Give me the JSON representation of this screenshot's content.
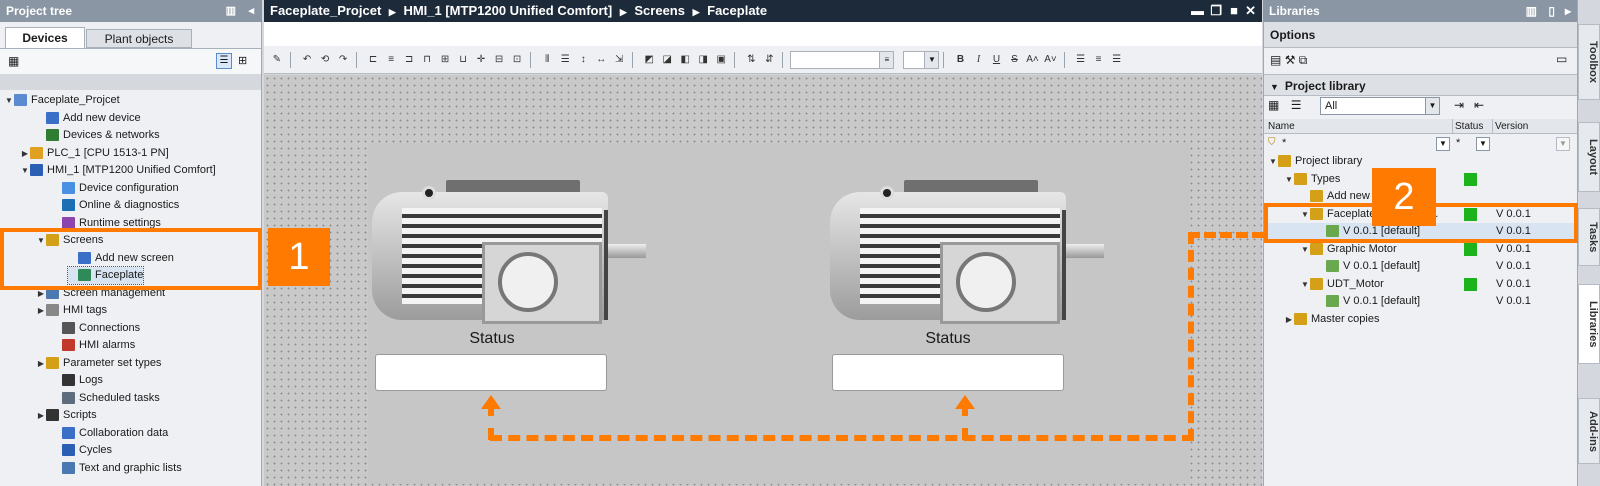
{
  "left_panel": {
    "title": "Project tree",
    "tabs": [
      "Devices",
      "Plant objects"
    ],
    "tree": [
      {
        "label": "Faceplate_Projcet",
        "indent": 0,
        "arrow": "▼"
      },
      {
        "label": "Add new device",
        "indent": 2,
        "arrow": ""
      },
      {
        "label": "Devices & networks",
        "indent": 2,
        "arrow": ""
      },
      {
        "label": "PLC_1 [CPU 1513-1 PN]",
        "indent": 1,
        "arrow": "▶"
      },
      {
        "label": "HMI_1 [MTP1200 Unified Comfort]",
        "indent": 1,
        "arrow": "▼"
      },
      {
        "label": "Device configuration",
        "indent": 3,
        "arrow": ""
      },
      {
        "label": "Online & diagnostics",
        "indent": 3,
        "arrow": ""
      },
      {
        "label": "Runtime settings",
        "indent": 3,
        "arrow": ""
      },
      {
        "label": "Screens",
        "indent": 2,
        "arrow": "▼"
      },
      {
        "label": "Add new screen",
        "indent": 4,
        "arrow": ""
      },
      {
        "label": "Faceplate",
        "indent": 4,
        "arrow": ""
      },
      {
        "label": "Screen management",
        "indent": 2,
        "arrow": "▶"
      },
      {
        "label": "HMI tags",
        "indent": 2,
        "arrow": "▶"
      },
      {
        "label": "Connections",
        "indent": 3,
        "arrow": ""
      },
      {
        "label": "HMI alarms",
        "indent": 3,
        "arrow": ""
      },
      {
        "label": "Parameter set types",
        "indent": 2,
        "arrow": "▶"
      },
      {
        "label": "Logs",
        "indent": 3,
        "arrow": ""
      },
      {
        "label": "Scheduled tasks",
        "indent": 3,
        "arrow": ""
      },
      {
        "label": "Scripts",
        "indent": 2,
        "arrow": "▶"
      },
      {
        "label": "Collaboration data",
        "indent": 3,
        "arrow": ""
      },
      {
        "label": "Cycles",
        "indent": 3,
        "arrow": ""
      },
      {
        "label": "Text and graphic lists",
        "indent": 3,
        "arrow": ""
      }
    ]
  },
  "editor": {
    "breadcrumb": [
      "Faceplate_Projcet",
      "HMI_1 [MTP1200 Unified Comfort]",
      "Screens",
      "Faceplate"
    ],
    "status_label_1": "Status",
    "status_label_2": "Status",
    "format_buttons": [
      "B",
      "I",
      "U",
      "S",
      "A˄",
      "A˅"
    ]
  },
  "right_panel": {
    "title": "Libraries",
    "options_label": "Options",
    "project_library_label": "Project library",
    "filter_value": "All",
    "columns": {
      "name": "Name",
      "status": "Status",
      "version": "Version"
    },
    "filter_row": {
      "name": "*",
      "status": "*"
    },
    "rows": [
      {
        "label": "Project library",
        "indent": 0,
        "arrow": "▼",
        "status": false,
        "version": ""
      },
      {
        "label": "Types",
        "indent": 1,
        "arrow": "▼",
        "status": true,
        "version": ""
      },
      {
        "label": "Add new type",
        "indent": 2,
        "arrow": "",
        "status": false,
        "version": ""
      },
      {
        "label": "Faceplate_Motor_Ba...",
        "indent": 2,
        "arrow": "▼",
        "status": true,
        "version": "V 0.0.1"
      },
      {
        "label": "V 0.0.1 [default]",
        "indent": 3,
        "arrow": "",
        "status": false,
        "version": "V 0.0.1"
      },
      {
        "label": "Graphic Motor",
        "indent": 2,
        "arrow": "▼",
        "status": true,
        "version": "V 0.0.1"
      },
      {
        "label": "V 0.0.1 [default]",
        "indent": 3,
        "arrow": "",
        "status": false,
        "version": "V 0.0.1"
      },
      {
        "label": "UDT_Motor",
        "indent": 2,
        "arrow": "▼",
        "status": true,
        "version": "V 0.0.1"
      },
      {
        "label": "V 0.0.1 [default]",
        "indent": 3,
        "arrow": "",
        "status": false,
        "version": "V 0.0.1"
      },
      {
        "label": "Master copies",
        "indent": 1,
        "arrow": "▶",
        "status": false,
        "version": ""
      }
    ]
  },
  "side_tabs": [
    "Toolbox",
    "Layout",
    "Tasks",
    "Libraries",
    "Add-ins"
  ],
  "callouts": {
    "one": "1",
    "two": "2"
  },
  "colors": {
    "accent": "#ff7a00",
    "header": "#8a96a4",
    "dark_header": "#1c2a3a",
    "canvas": "#c9c9c9",
    "status_green": "#1db31d"
  }
}
